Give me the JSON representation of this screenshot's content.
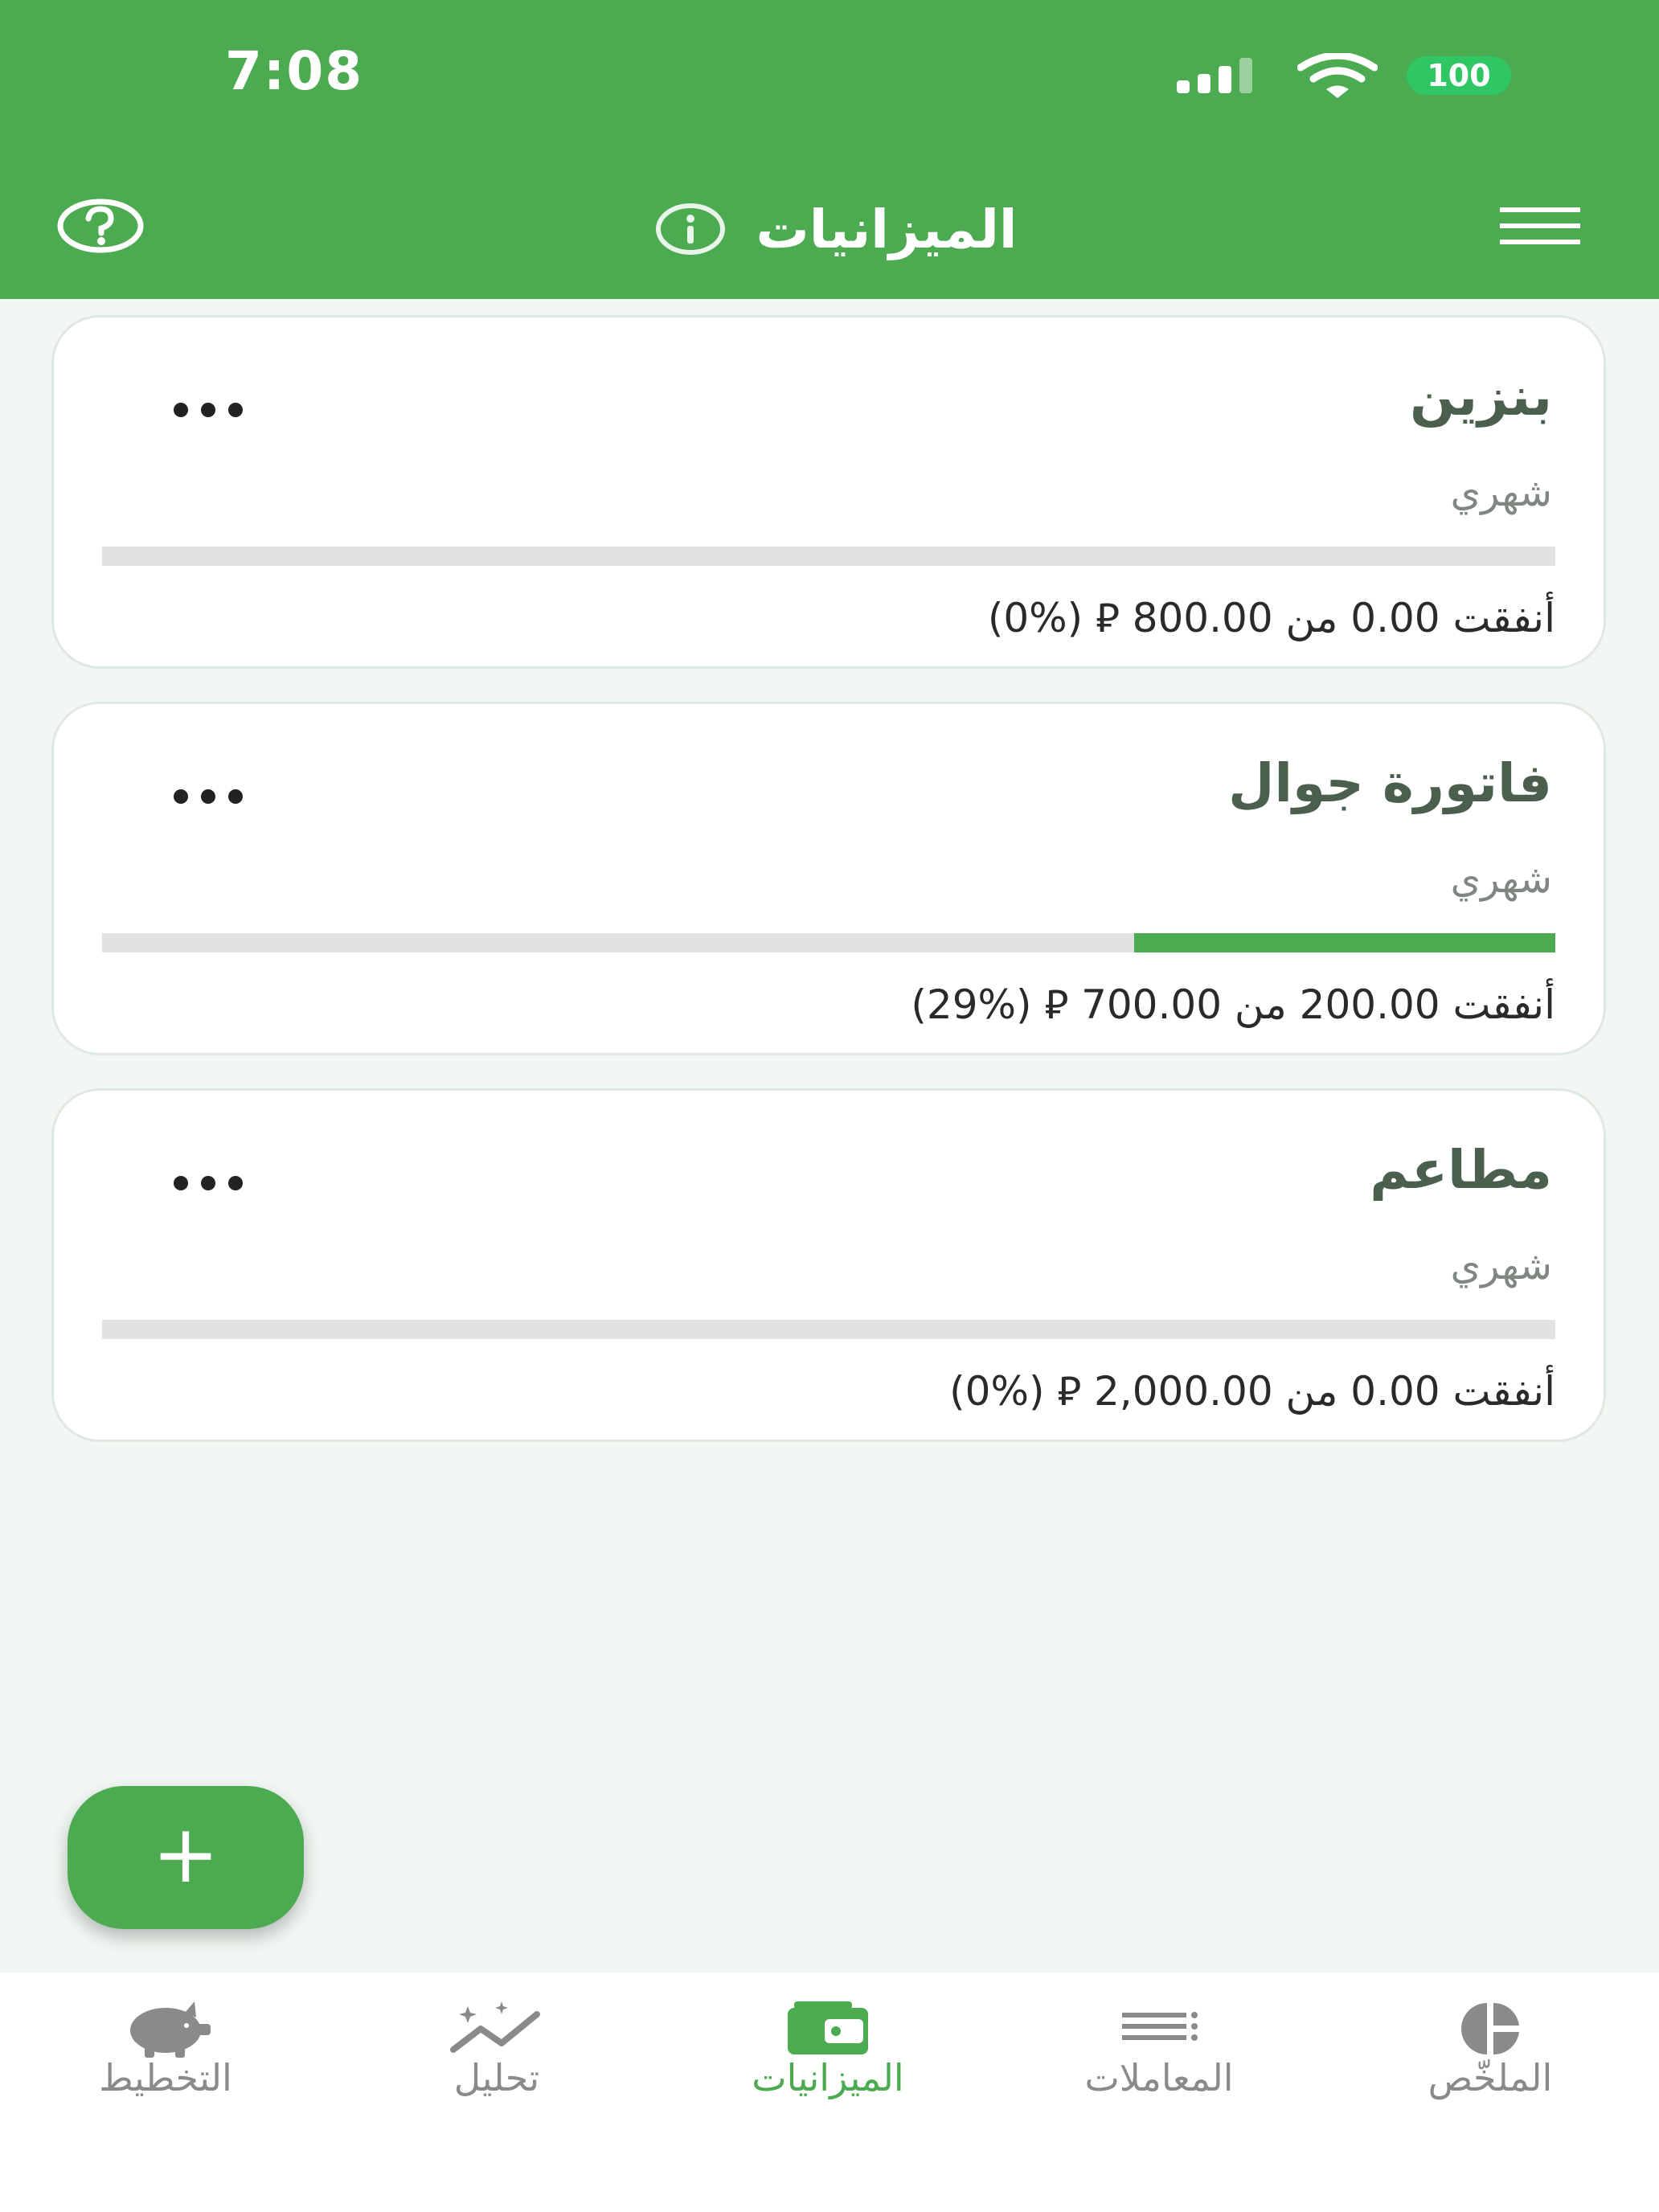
{
  "status_bar": {
    "time": "7:08",
    "battery": "100"
  },
  "header": {
    "title": "الميزانيات"
  },
  "budgets": [
    {
      "name": "بنزين",
      "period": "شهري",
      "spent_text": "أنفقت 0.00 من 800.00 ⃁ (%0)",
      "progress_percent": 0
    },
    {
      "name": "فاتورة جوال",
      "period": "شهري",
      "spent_text": "أنفقت 200.00 من 700.00 ⃁ (%29)",
      "progress_percent": 29
    },
    {
      "name": "مطاعم",
      "period": "شهري",
      "spent_text": "أنفقت 0.00 من 2,000.00 ⃁ (%0)",
      "progress_percent": 0
    }
  ],
  "fab": {
    "label": "+"
  },
  "nav": {
    "summary": "الملخّص",
    "transactions": "المعاملات",
    "budgets": "الميزانيات",
    "analysis": "تحليل",
    "planning": "التخطيط",
    "active": "budgets"
  },
  "colors": {
    "primary": "#4caa50",
    "background": "#f1f7f2",
    "inactive": "#8a8a8a"
  },
  "icons": [
    "help-icon",
    "info-icon",
    "menu-icon",
    "more-icon",
    "pie-chart-icon",
    "list-icon",
    "wallet-icon",
    "trend-icon",
    "piggy-bank-icon"
  ]
}
